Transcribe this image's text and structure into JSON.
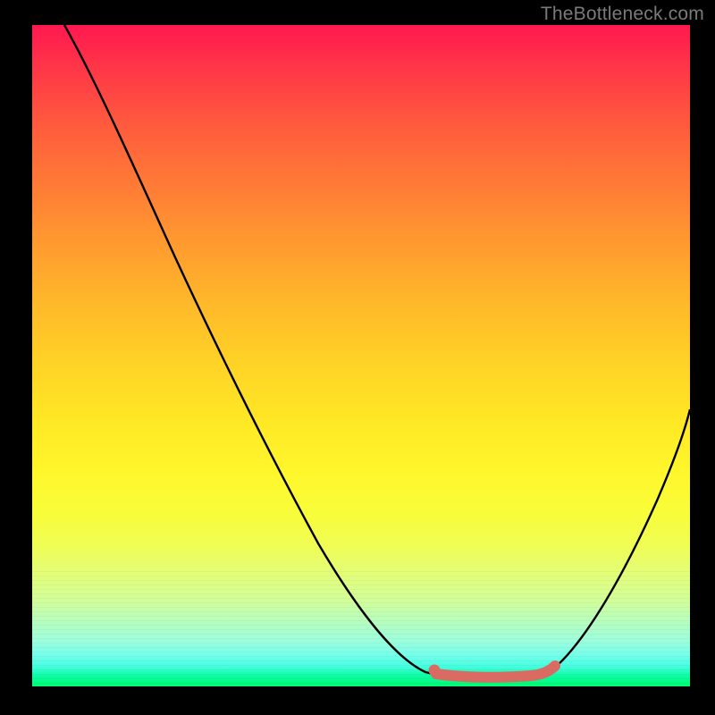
{
  "watermark": "TheBottleneck.com",
  "colors": {
    "background": "#000000",
    "curve": "#000000",
    "marker": "#d96b63",
    "watermark_text": "#7a7a7a"
  },
  "chart_data": {
    "type": "line",
    "title": "",
    "xlabel": "",
    "ylabel": "",
    "xlim": [
      0,
      100
    ],
    "ylim": [
      0,
      100
    ],
    "grid": false,
    "series": [
      {
        "name": "bottleneck-curve",
        "x": [
          5,
          12,
          20,
          28,
          36,
          44,
          52,
          58,
          62,
          66,
          70,
          74,
          78,
          82,
          86,
          90,
          94,
          98,
          100
        ],
        "y": [
          100,
          88,
          73,
          58,
          44,
          31,
          18,
          8,
          3,
          1,
          1,
          1,
          2,
          6,
          13,
          22,
          32,
          42,
          48
        ]
      }
    ],
    "markers": [
      {
        "name": "start-dot",
        "x": 62,
        "y": 2.1,
        "r": 6,
        "color": "#d96b63"
      }
    ],
    "highlight_segment": {
      "name": "bottom-bar",
      "x": [
        62,
        78.5
      ],
      "y": [
        1,
        2.3
      ],
      "stroke_width": 12,
      "color": "#d96b63"
    }
  }
}
